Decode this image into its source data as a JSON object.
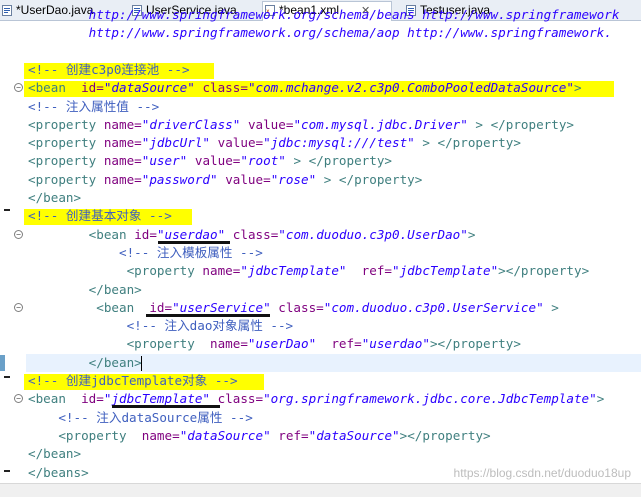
{
  "tabs": [
    {
      "label": "*UserDao.java",
      "icon": "java-file-icon"
    },
    {
      "label": "UserService.java",
      "icon": "java-file-icon"
    },
    {
      "label": "*bean1.xml",
      "icon": "xml-file-icon",
      "close": "✕"
    },
    {
      "label": "Testuser.java",
      "icon": "java-file-icon"
    }
  ],
  "lines": [
    [
      {
        "t": "        ",
        "c": "txt"
      },
      {
        "t": "http://www.springframework.org/schema/beans http://www.springframework",
        "c": "val"
      }
    ],
    [
      {
        "t": "        ",
        "c": "txt"
      },
      {
        "t": "http://www.springframework.org/schema/aop http://www.springframework.",
        "c": "val"
      }
    ],
    [],
    [
      {
        "t": "<!-- 创建c3p0连接池 -->",
        "c": "cmt"
      }
    ],
    [
      {
        "t": "<bean",
        "c": "tag"
      },
      {
        "t": "  ",
        "c": "txt"
      },
      {
        "t": "id=",
        "c": "attr"
      },
      {
        "t": "\"dataSource\"",
        "c": "val"
      },
      {
        "t": " ",
        "c": "txt"
      },
      {
        "t": "class=",
        "c": "attr"
      },
      {
        "t": "\"com.mchange.v2.c3p0.ComboPooledDataSource\"",
        "c": "val"
      },
      {
        "t": ">",
        "c": "tag"
      }
    ],
    [
      {
        "t": "<!-- 注入属性值 -->",
        "c": "cmt"
      }
    ],
    [
      {
        "t": "<property",
        "c": "tag"
      },
      {
        "t": " ",
        "c": "txt"
      },
      {
        "t": "name=",
        "c": "attr"
      },
      {
        "t": "\"driverClass\"",
        "c": "val"
      },
      {
        "t": " ",
        "c": "txt"
      },
      {
        "t": "value=",
        "c": "attr"
      },
      {
        "t": "\"com.mysql.jdbc.Driver\"",
        "c": "val"
      },
      {
        "t": " > </property>",
        "c": "tag"
      }
    ],
    [
      {
        "t": "<property",
        "c": "tag"
      },
      {
        "t": " ",
        "c": "txt"
      },
      {
        "t": "name=",
        "c": "attr"
      },
      {
        "t": "\"jdbcUrl\"",
        "c": "val"
      },
      {
        "t": " ",
        "c": "txt"
      },
      {
        "t": "value=",
        "c": "attr"
      },
      {
        "t": "\"jdbc:mysql:///test\"",
        "c": "val"
      },
      {
        "t": " > </property>",
        "c": "tag"
      }
    ],
    [
      {
        "t": "<property",
        "c": "tag"
      },
      {
        "t": " ",
        "c": "txt"
      },
      {
        "t": "name=",
        "c": "attr"
      },
      {
        "t": "\"user\"",
        "c": "val"
      },
      {
        "t": " ",
        "c": "txt"
      },
      {
        "t": "value=",
        "c": "attr"
      },
      {
        "t": "\"root\"",
        "c": "val"
      },
      {
        "t": " > </property>",
        "c": "tag"
      }
    ],
    [
      {
        "t": "<property",
        "c": "tag"
      },
      {
        "t": " ",
        "c": "txt"
      },
      {
        "t": "name=",
        "c": "attr"
      },
      {
        "t": "\"password\"",
        "c": "val"
      },
      {
        "t": " ",
        "c": "txt"
      },
      {
        "t": "value=",
        "c": "attr"
      },
      {
        "t": "\"rose\"",
        "c": "val"
      },
      {
        "t": " > </property>",
        "c": "tag"
      }
    ],
    [
      {
        "t": "</bean>",
        "c": "tag"
      }
    ],
    [
      {
        "t": "<!-- 创建基本对象 -->",
        "c": "cmt"
      }
    ],
    [
      {
        "t": "        ",
        "c": "txt"
      },
      {
        "t": "<bean",
        "c": "tag"
      },
      {
        "t": " ",
        "c": "txt"
      },
      {
        "t": "id=",
        "c": "attr"
      },
      {
        "t": "\"userdao\"",
        "c": "val"
      },
      {
        "t": " ",
        "c": "txt"
      },
      {
        "t": "class=",
        "c": "attr"
      },
      {
        "t": "\"com.duoduo.c3p0.UserDao\"",
        "c": "val"
      },
      {
        "t": ">",
        "c": "tag"
      }
    ],
    [
      {
        "t": "            ",
        "c": "txt"
      },
      {
        "t": "<!-- 注入模板属性 -->",
        "c": "cmt"
      }
    ],
    [
      {
        "t": "             ",
        "c": "txt"
      },
      {
        "t": "<property",
        "c": "tag"
      },
      {
        "t": " ",
        "c": "txt"
      },
      {
        "t": "name=",
        "c": "attr"
      },
      {
        "t": "\"jdbcTemplate\"",
        "c": "val"
      },
      {
        "t": "  ",
        "c": "txt"
      },
      {
        "t": "ref=",
        "c": "attr"
      },
      {
        "t": "\"jdbcTemplate\"",
        "c": "val"
      },
      {
        "t": "></property>",
        "c": "tag"
      }
    ],
    [
      {
        "t": "        ",
        "c": "txt"
      },
      {
        "t": "</bean>",
        "c": "tag"
      }
    ],
    [
      {
        "t": "         ",
        "c": "txt"
      },
      {
        "t": "<bean",
        "c": "tag"
      },
      {
        "t": "  ",
        "c": "txt"
      },
      {
        "t": "id=",
        "c": "attr"
      },
      {
        "t": "\"userService\"",
        "c": "val"
      },
      {
        "t": " ",
        "c": "txt"
      },
      {
        "t": "class=",
        "c": "attr"
      },
      {
        "t": "\"com.duoduo.c3p0.UserService\"",
        "c": "val"
      },
      {
        "t": " >",
        "c": "tag"
      }
    ],
    [
      {
        "t": "             ",
        "c": "txt"
      },
      {
        "t": "<!-- 注入dao对象属性 -->",
        "c": "cmt"
      }
    ],
    [
      {
        "t": "             ",
        "c": "txt"
      },
      {
        "t": "<property",
        "c": "tag"
      },
      {
        "t": "  ",
        "c": "txt"
      },
      {
        "t": "name=",
        "c": "attr"
      },
      {
        "t": "\"userDao\"",
        "c": "val"
      },
      {
        "t": "  ",
        "c": "txt"
      },
      {
        "t": "ref=",
        "c": "attr"
      },
      {
        "t": "\"userdao\"",
        "c": "val"
      },
      {
        "t": "></property>",
        "c": "tag"
      }
    ],
    [
      {
        "t": "        ",
        "c": "txt"
      },
      {
        "t": "</bean>",
        "c": "tag"
      }
    ],
    [
      {
        "t": "<!-- 创建jdbcTemplate对象 -->",
        "c": "cmt"
      }
    ],
    [
      {
        "t": "<bean",
        "c": "tag"
      },
      {
        "t": "  ",
        "c": "txt"
      },
      {
        "t": "id=",
        "c": "attr"
      },
      {
        "t": "\"jdbcTemplate\"",
        "c": "val"
      },
      {
        "t": " ",
        "c": "txt"
      },
      {
        "t": "class=",
        "c": "attr"
      },
      {
        "t": "\"org.springframework.jdbc.core.JdbcTemplate\"",
        "c": "val"
      },
      {
        "t": ">",
        "c": "tag"
      }
    ],
    [
      {
        "t": "    ",
        "c": "txt"
      },
      {
        "t": "<!-- 注入dataSource属性 -->",
        "c": "cmt"
      }
    ],
    [
      {
        "t": "    ",
        "c": "txt"
      },
      {
        "t": "<property",
        "c": "tag"
      },
      {
        "t": "  ",
        "c": "txt"
      },
      {
        "t": "name=",
        "c": "attr"
      },
      {
        "t": "\"dataSource\"",
        "c": "val"
      },
      {
        "t": " ",
        "c": "txt"
      },
      {
        "t": "ref=",
        "c": "attr"
      },
      {
        "t": "\"dataSource\"",
        "c": "val"
      },
      {
        "t": "></property>",
        "c": "tag"
      }
    ],
    [
      {
        "t": "</bean>",
        "c": "tag"
      }
    ],
    [
      {
        "t": "</beans>",
        "c": "tag"
      }
    ]
  ],
  "watermark": "https://blog.csdn.net/duoduo18up",
  "colors": {
    "highlight": "#ffff00",
    "tag": "#3f7f7f",
    "attr": "#7f007f",
    "value": "#2a00ff",
    "comment": "#3f5fbf"
  }
}
